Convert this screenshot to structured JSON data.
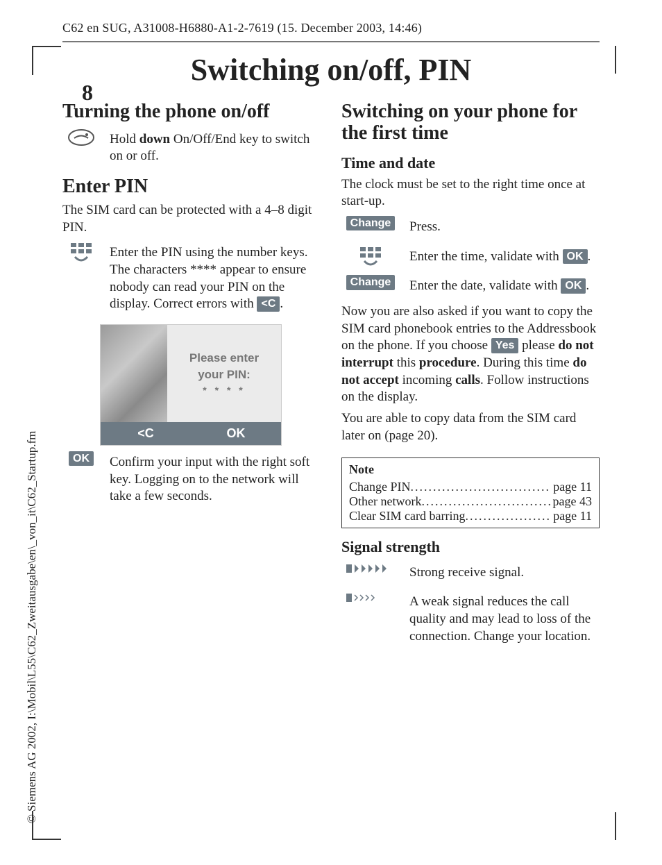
{
  "header": "C62 en SUG, A31008-H6880-A1-2-7619 (15. December 2003, 14:46)",
  "page_number": "8",
  "chapter_title": "Switching on/off, PIN",
  "side_copyright": "© Siemens AG 2002, I:\\Mobil\\L55\\C62_Zweitausgabe\\en\\_von_it\\C62_Startup.fm",
  "left": {
    "h_onoff": "Turning the phone on/off",
    "onoff_text_pre": "Hold ",
    "onoff_text_bold": "down",
    "onoff_text_post": " On/Off/End key to switch on or off.",
    "h_pin": "Enter PIN",
    "pin_intro": "The SIM card can be protected with a 4–8 digit PIN.",
    "pin_enter_text": "Enter the PIN using the number keys. The characters **** appear to ensure nobody can read your PIN on the display. Correct errors with ",
    "key_clear": "<C",
    "pin_enter_tail": ".",
    "screen_l1": "Please enter",
    "screen_l2": "your PIN:",
    "screen_stars": "* * * *",
    "soft_left": "<C",
    "soft_right": "OK",
    "key_ok": "OK",
    "ok_text": "Confirm your input with the right soft key. Logging on to the network will take a few seconds."
  },
  "right": {
    "h_first": "Switching on your phone for the first time",
    "h_timedate": "Time and date",
    "timedate_intro": "The clock must be set to the right time once at start-up.",
    "key_change": "Change",
    "press": "Press.",
    "time_pre": "Enter the time, validate with ",
    "date_pre": "Enter the date, validate with ",
    "key_ok": "OK",
    "tail_dot": ".",
    "copy_p1a": "Now you are also asked if you want to copy the SIM card phonebook entries to the Addressbook on the phone. If you choose ",
    "key_yes": "Yes",
    "copy_p1b": " please ",
    "copy_b1": "do not interrupt",
    "copy_p1c": " this ",
    "copy_b2": "procedure",
    "copy_p1d": ". During this time ",
    "copy_b3": "do not accept",
    "copy_p1e": " incoming ",
    "copy_b4": "calls",
    "copy_p1f": ". Follow instructions on the display.",
    "copy_p2": "You are able to copy data from the SIM card later on (page 20).",
    "note_title": "Note",
    "notes": [
      {
        "label": "Change PIN",
        "page": "page 11"
      },
      {
        "label": "Other network",
        "page": "page 43"
      },
      {
        "label": "Clear SIM card barring",
        "page": "page 11"
      }
    ],
    "h_signal": "Signal strength",
    "sig_strong": "Strong receive signal.",
    "sig_weak": "A weak signal reduces the call quality and may lead to loss of the connection. Change your location."
  }
}
